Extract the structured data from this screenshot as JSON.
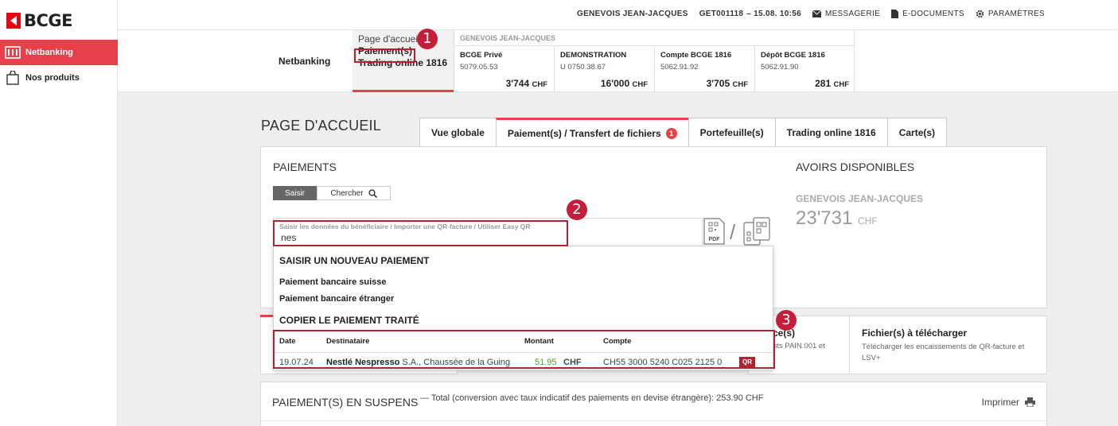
{
  "brand": {
    "logo_text": "BCGE",
    "accent": "#e8404b",
    "dark_red": "#b0242f"
  },
  "sidebar": {
    "items": [
      {
        "label": "Netbanking",
        "icon": "bank-icon",
        "active": true
      },
      {
        "label": "Nos produits",
        "icon": "shopping-bag-icon",
        "active": false
      }
    ]
  },
  "topbar": {
    "user": "GENEVOIS JEAN-JACQUES",
    "session": "GET001118",
    "datetime": "– 15.08. 10:56",
    "links": [
      {
        "label": "MESSAGERIE",
        "icon": "envelope-icon"
      },
      {
        "label": "E-DOCUMENTS",
        "icon": "document-icon"
      },
      {
        "label": "PARAMÈTRES",
        "icon": "gear-icon"
      }
    ]
  },
  "accounts_strip": {
    "title": "Netbanking",
    "quick_links": [
      "Page d'accueil",
      "Paiement(s)",
      "Trading online 1816"
    ],
    "owner": "GENEVOIS JEAN-JACQUES",
    "accounts": [
      {
        "name": "BCGE Privé",
        "number": "5079.05.53",
        "balance": "3'744",
        "currency": "CHF"
      },
      {
        "name": "DEMONSTRATION",
        "number": "U 0750.38.67",
        "balance": "16'000",
        "currency": "CHF"
      },
      {
        "name": "Compte BCGE 1816",
        "number": "5062.91.92",
        "balance": "3'705",
        "currency": "CHF"
      },
      {
        "name": "Dépôt BCGE 1816",
        "number": "5062.91.90",
        "balance": "281",
        "currency": "CHF"
      }
    ]
  },
  "annotations": [
    "1",
    "2",
    "3"
  ],
  "page": {
    "title": "PAGE D'ACCUEIL",
    "tabs": [
      {
        "label": "Vue globale",
        "active": false
      },
      {
        "label": "Paiement(s) / Transfert de fichiers",
        "active": true,
        "count": "1"
      },
      {
        "label": "Portefeuille(s)",
        "active": false
      },
      {
        "label": "Trading online 1816",
        "active": false
      },
      {
        "label": "Carte(s)",
        "active": false
      }
    ]
  },
  "payments": {
    "title": "PAIEMENTS",
    "btn_saisir": "Saisir",
    "btn_chercher": "Chercher",
    "entry_label": "Saisir les données du bénéficiaire / Importer une QR-facture / Utiliser Easy QR",
    "entry_value": "nes",
    "pdf_label": "PDF"
  },
  "avoirs": {
    "title": "AVOIRS DISPONIBLES",
    "owner": "GENEVOIS JEAN-JACQUES",
    "amount": "23'731",
    "currency": "CHF"
  },
  "dropdown": {
    "section_new": "SAISIR UN NOUVEAU PAIEMENT",
    "items": [
      "Paiement bancaire suisse",
      "Paiement bancaire étranger"
    ],
    "section_copy": "COPIER LE PAIEMENT TRAITÉ",
    "columns": [
      "Date",
      "Destinataire",
      "Montant",
      "Compte"
    ],
    "row": {
      "date": "19.07.24",
      "recipient_bold": "Nestlé Nespresso",
      "recipient_rest": "S.A., Chaussée de la Guing",
      "amount": "51.95",
      "currency": "CHF",
      "account": "CH55 3000 5240 C025 2125 0",
      "tag": "QR"
    }
  },
  "panels": {
    "mid_title": "ce(s)",
    "mid_desc": "nts PAIN.001 et",
    "download_title": "Fichier(s) à télécharger",
    "download_desc": "Télécharger les encaissements de QR-facture et LSV+"
  },
  "suspens": {
    "title": "PAIEMENT(S) EN SUSPENS",
    "total": "— Total (conversion avec taux indicatif des paiements en devise étrangère): 253.90 CHF",
    "print": "Imprimer"
  }
}
